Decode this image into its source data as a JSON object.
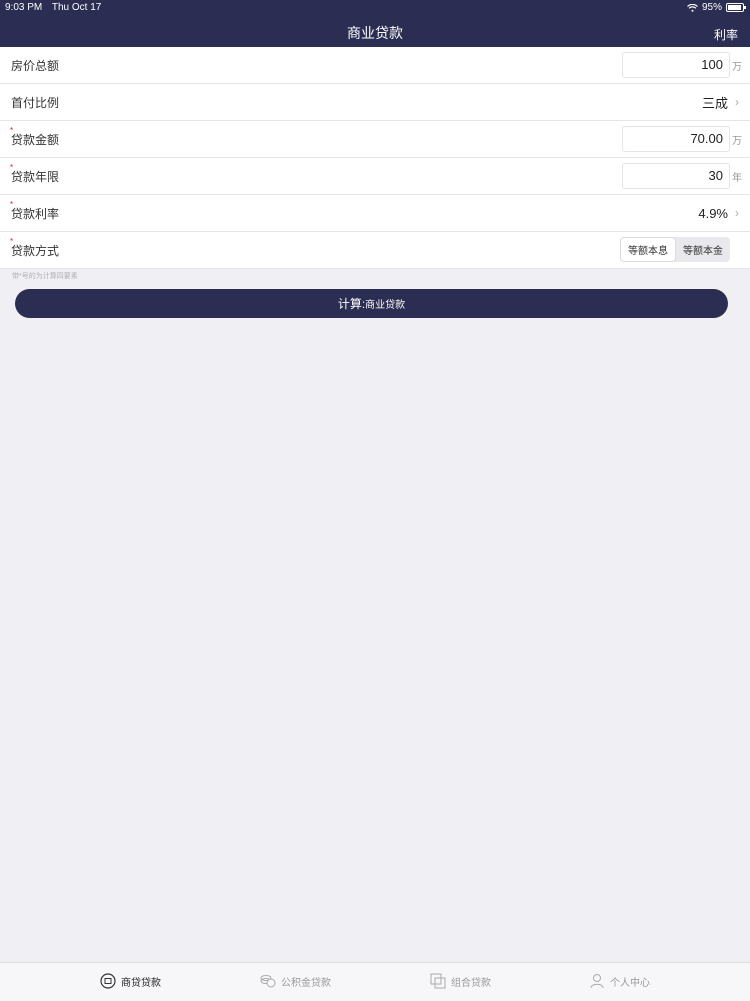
{
  "status": {
    "time": "9:03 PM",
    "date": "Thu Oct 17",
    "battery": "95%"
  },
  "nav": {
    "title": "商业贷款",
    "right": "利率"
  },
  "form": {
    "house_price": {
      "label": "房价总额",
      "value": "100",
      "unit": "万"
    },
    "down_payment": {
      "label": "首付比例",
      "value": "三成"
    },
    "loan_amount": {
      "label": "贷款金额",
      "value": "70.00",
      "unit": "万"
    },
    "loan_term": {
      "label": "贷款年限",
      "value": "30",
      "unit": "年"
    },
    "interest_rate": {
      "label": "贷款利率",
      "value": "4.9%"
    },
    "repayment": {
      "label": "贷款方式",
      "options": [
        "等额本息",
        "等额本金"
      ],
      "selected": "等额本息"
    },
    "required_mark": "*"
  },
  "hint": "带*号的为计算四要素",
  "calculate": {
    "label": "计算:",
    "sub": "商业贷款"
  },
  "tabs": [
    {
      "label": "商贷贷款",
      "icon": "house-icon",
      "active": true
    },
    {
      "label": "公积金贷款",
      "icon": "coins-icon",
      "active": false
    },
    {
      "label": "组合贷款",
      "icon": "combine-icon",
      "active": false
    },
    {
      "label": "个人中心",
      "icon": "person-icon",
      "active": false
    }
  ],
  "colors": {
    "primary": "#2b2d52",
    "background": "#efeff4",
    "required": "#e02020"
  }
}
